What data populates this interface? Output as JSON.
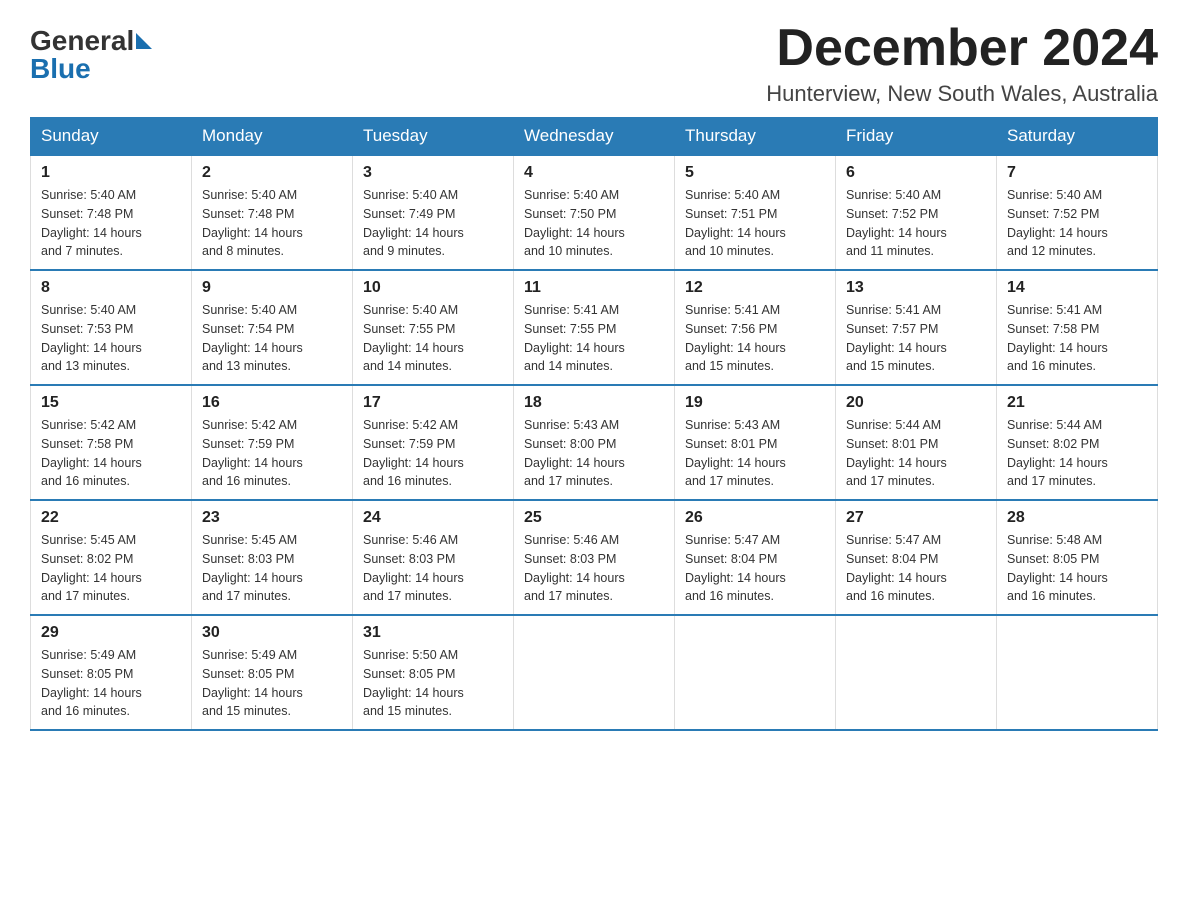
{
  "header": {
    "logo_general": "General",
    "logo_blue": "Blue",
    "month_title": "December 2024",
    "location": "Hunterview, New South Wales, Australia"
  },
  "days_of_week": [
    "Sunday",
    "Monday",
    "Tuesday",
    "Wednesday",
    "Thursday",
    "Friday",
    "Saturday"
  ],
  "weeks": [
    [
      {
        "day": "1",
        "sunrise": "5:40 AM",
        "sunset": "7:48 PM",
        "daylight": "14 hours and 7 minutes."
      },
      {
        "day": "2",
        "sunrise": "5:40 AM",
        "sunset": "7:48 PM",
        "daylight": "14 hours and 8 minutes."
      },
      {
        "day": "3",
        "sunrise": "5:40 AM",
        "sunset": "7:49 PM",
        "daylight": "14 hours and 9 minutes."
      },
      {
        "day": "4",
        "sunrise": "5:40 AM",
        "sunset": "7:50 PM",
        "daylight": "14 hours and 10 minutes."
      },
      {
        "day": "5",
        "sunrise": "5:40 AM",
        "sunset": "7:51 PM",
        "daylight": "14 hours and 10 minutes."
      },
      {
        "day": "6",
        "sunrise": "5:40 AM",
        "sunset": "7:52 PM",
        "daylight": "14 hours and 11 minutes."
      },
      {
        "day": "7",
        "sunrise": "5:40 AM",
        "sunset": "7:52 PM",
        "daylight": "14 hours and 12 minutes."
      }
    ],
    [
      {
        "day": "8",
        "sunrise": "5:40 AM",
        "sunset": "7:53 PM",
        "daylight": "14 hours and 13 minutes."
      },
      {
        "day": "9",
        "sunrise": "5:40 AM",
        "sunset": "7:54 PM",
        "daylight": "14 hours and 13 minutes."
      },
      {
        "day": "10",
        "sunrise": "5:40 AM",
        "sunset": "7:55 PM",
        "daylight": "14 hours and 14 minutes."
      },
      {
        "day": "11",
        "sunrise": "5:41 AM",
        "sunset": "7:55 PM",
        "daylight": "14 hours and 14 minutes."
      },
      {
        "day": "12",
        "sunrise": "5:41 AM",
        "sunset": "7:56 PM",
        "daylight": "14 hours and 15 minutes."
      },
      {
        "day": "13",
        "sunrise": "5:41 AM",
        "sunset": "7:57 PM",
        "daylight": "14 hours and 15 minutes."
      },
      {
        "day": "14",
        "sunrise": "5:41 AM",
        "sunset": "7:58 PM",
        "daylight": "14 hours and 16 minutes."
      }
    ],
    [
      {
        "day": "15",
        "sunrise": "5:42 AM",
        "sunset": "7:58 PM",
        "daylight": "14 hours and 16 minutes."
      },
      {
        "day": "16",
        "sunrise": "5:42 AM",
        "sunset": "7:59 PM",
        "daylight": "14 hours and 16 minutes."
      },
      {
        "day": "17",
        "sunrise": "5:42 AM",
        "sunset": "7:59 PM",
        "daylight": "14 hours and 16 minutes."
      },
      {
        "day": "18",
        "sunrise": "5:43 AM",
        "sunset": "8:00 PM",
        "daylight": "14 hours and 17 minutes."
      },
      {
        "day": "19",
        "sunrise": "5:43 AM",
        "sunset": "8:01 PM",
        "daylight": "14 hours and 17 minutes."
      },
      {
        "day": "20",
        "sunrise": "5:44 AM",
        "sunset": "8:01 PM",
        "daylight": "14 hours and 17 minutes."
      },
      {
        "day": "21",
        "sunrise": "5:44 AM",
        "sunset": "8:02 PM",
        "daylight": "14 hours and 17 minutes."
      }
    ],
    [
      {
        "day": "22",
        "sunrise": "5:45 AM",
        "sunset": "8:02 PM",
        "daylight": "14 hours and 17 minutes."
      },
      {
        "day": "23",
        "sunrise": "5:45 AM",
        "sunset": "8:03 PM",
        "daylight": "14 hours and 17 minutes."
      },
      {
        "day": "24",
        "sunrise": "5:46 AM",
        "sunset": "8:03 PM",
        "daylight": "14 hours and 17 minutes."
      },
      {
        "day": "25",
        "sunrise": "5:46 AM",
        "sunset": "8:03 PM",
        "daylight": "14 hours and 17 minutes."
      },
      {
        "day": "26",
        "sunrise": "5:47 AM",
        "sunset": "8:04 PM",
        "daylight": "14 hours and 16 minutes."
      },
      {
        "day": "27",
        "sunrise": "5:47 AM",
        "sunset": "8:04 PM",
        "daylight": "14 hours and 16 minutes."
      },
      {
        "day": "28",
        "sunrise": "5:48 AM",
        "sunset": "8:05 PM",
        "daylight": "14 hours and 16 minutes."
      }
    ],
    [
      {
        "day": "29",
        "sunrise": "5:49 AM",
        "sunset": "8:05 PM",
        "daylight": "14 hours and 16 minutes."
      },
      {
        "day": "30",
        "sunrise": "5:49 AM",
        "sunset": "8:05 PM",
        "daylight": "14 hours and 15 minutes."
      },
      {
        "day": "31",
        "sunrise": "5:50 AM",
        "sunset": "8:05 PM",
        "daylight": "14 hours and 15 minutes."
      },
      null,
      null,
      null,
      null
    ]
  ],
  "labels": {
    "sunrise": "Sunrise:",
    "sunset": "Sunset:",
    "daylight": "Daylight:"
  }
}
